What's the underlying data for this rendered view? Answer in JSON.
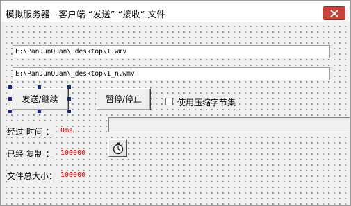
{
  "window": {
    "title": "模拟服务器 - 客户端 “发送” “接收” 文件"
  },
  "inputs": {
    "source_path": "E:\\PanJunQuan\\_desktop\\1.wmv",
    "dest_path": "E:\\PanJunQuan\\_desktop\\1_n.wmv"
  },
  "buttons": {
    "send_continue": "发送/继续",
    "pause_stop": "暂停/停止"
  },
  "checkbox": {
    "label": "使用压缩字节集",
    "checked": false
  },
  "stats": {
    "elapsed_label": "经过 时间 ：",
    "elapsed_value": "0ms",
    "copied_label": "已经 复制 ：",
    "copied_value": "100000",
    "total_label": "文件总大小：",
    "total_value": "100000"
  },
  "icons": {
    "close": "close-icon",
    "timer": "stopwatch-icon"
  },
  "colors": {
    "accent_value": "#d00000",
    "close_button": "#c7433a",
    "selection_handle": "#1a2a7a"
  }
}
